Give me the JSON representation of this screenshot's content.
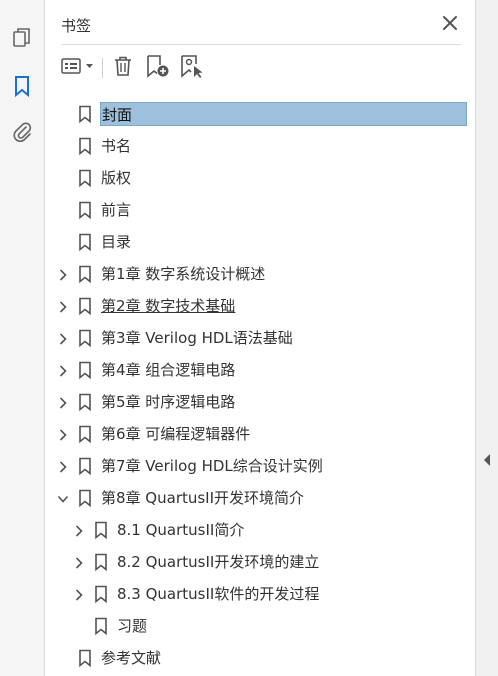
{
  "panel": {
    "title": "书签"
  },
  "rail": {
    "icons": [
      "pages-icon",
      "bookmark-icon",
      "attachment-icon"
    ]
  },
  "toolbar": {
    "icons": [
      "options-menu-icon",
      "delete-icon",
      "new-bookmark-icon",
      "bookmark-from-selection-icon"
    ]
  },
  "bookmarks": [
    {
      "label": "封面",
      "level": 0,
      "expandable": false,
      "expanded": false,
      "selected": true
    },
    {
      "label": "书名",
      "level": 0,
      "expandable": false,
      "expanded": false
    },
    {
      "label": "版权",
      "level": 0,
      "expandable": false,
      "expanded": false
    },
    {
      "label": "前言",
      "level": 0,
      "expandable": false,
      "expanded": false
    },
    {
      "label": "目录",
      "level": 0,
      "expandable": false,
      "expanded": false
    },
    {
      "label": "第1章  数字系统设计概述",
      "level": 0,
      "expandable": true,
      "expanded": false
    },
    {
      "label": "第2章  数字技术基础",
      "level": 0,
      "expandable": true,
      "expanded": false,
      "underlined": true
    },
    {
      "label": "第3章  Verilog HDL语法基础",
      "level": 0,
      "expandable": true,
      "expanded": false
    },
    {
      "label": "第4章  组合逻辑电路",
      "level": 0,
      "expandable": true,
      "expanded": false
    },
    {
      "label": "第5章  时序逻辑电路",
      "level": 0,
      "expandable": true,
      "expanded": false
    },
    {
      "label": "第6章  可编程逻辑器件",
      "level": 0,
      "expandable": true,
      "expanded": false
    },
    {
      "label": "第7章  Verilog HDL综合设计实例",
      "level": 0,
      "expandable": true,
      "expanded": false
    },
    {
      "label": "第8章  QuartusII开发环境简介",
      "level": 0,
      "expandable": true,
      "expanded": true
    },
    {
      "label": "8.1  QuartusII简介",
      "level": 1,
      "expandable": true,
      "expanded": false
    },
    {
      "label": "8.2  QuartusII开发环境的建立",
      "level": 1,
      "expandable": true,
      "expanded": false
    },
    {
      "label": "8.3  QuartusII软件的开发过程",
      "level": 1,
      "expandable": true,
      "expanded": false
    },
    {
      "label": "习题",
      "level": 1,
      "expandable": false,
      "expanded": false
    },
    {
      "label": "参考文献",
      "level": 0,
      "expandable": false,
      "expanded": false
    }
  ]
}
